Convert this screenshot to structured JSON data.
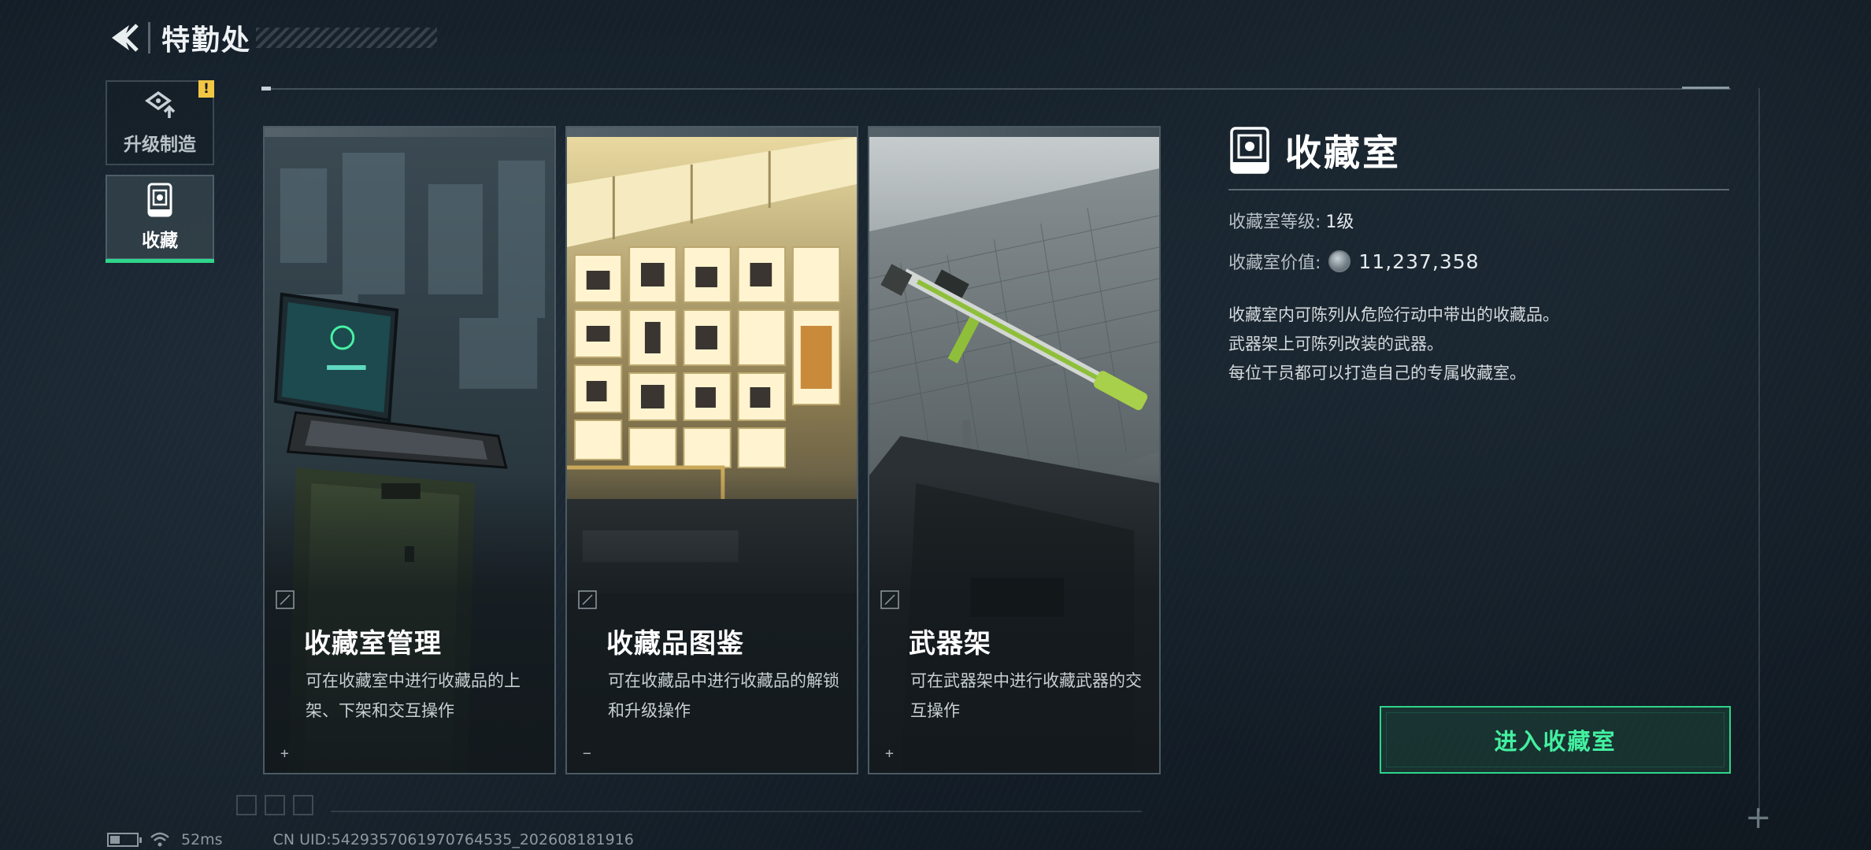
{
  "header": {
    "title": "特勤处"
  },
  "nav": {
    "items": [
      {
        "label": "升级制造",
        "icon": "upgrade-craft-icon",
        "alert": "!",
        "active": false
      },
      {
        "label": "收藏",
        "icon": "collection-room-icon",
        "active": true
      }
    ]
  },
  "cards": [
    {
      "title": "收藏室管理",
      "desc": "可在收藏室中进行收藏品的上架、下架和交互操作",
      "corner": "+"
    },
    {
      "title": "收藏品图鉴",
      "desc": "可在收藏品中进行收藏品的解锁和升级操作",
      "corner": "−"
    },
    {
      "title": "武器架",
      "desc": "可在武器架中进行收藏武器的交互操作",
      "corner": "+"
    }
  ],
  "info": {
    "title": "收藏室",
    "level_label": "收藏室等级:",
    "level_value": "1级",
    "value_label": "收藏室价值:",
    "value_amount": "11,237,358",
    "desc_lines": [
      "收藏室内可陈列从危险行动中带出的收藏品。",
      "武器架上可陈列改装的武器。",
      "每位干员都可以打造自己的专属收藏室。"
    ]
  },
  "enter_button": {
    "label": "进入收藏室"
  },
  "status": {
    "ping": "52ms",
    "uid": "CN UID:5429357061970764535_202608181916"
  },
  "colors": {
    "accent": "#2fd58a",
    "alert": "#f2c744"
  }
}
